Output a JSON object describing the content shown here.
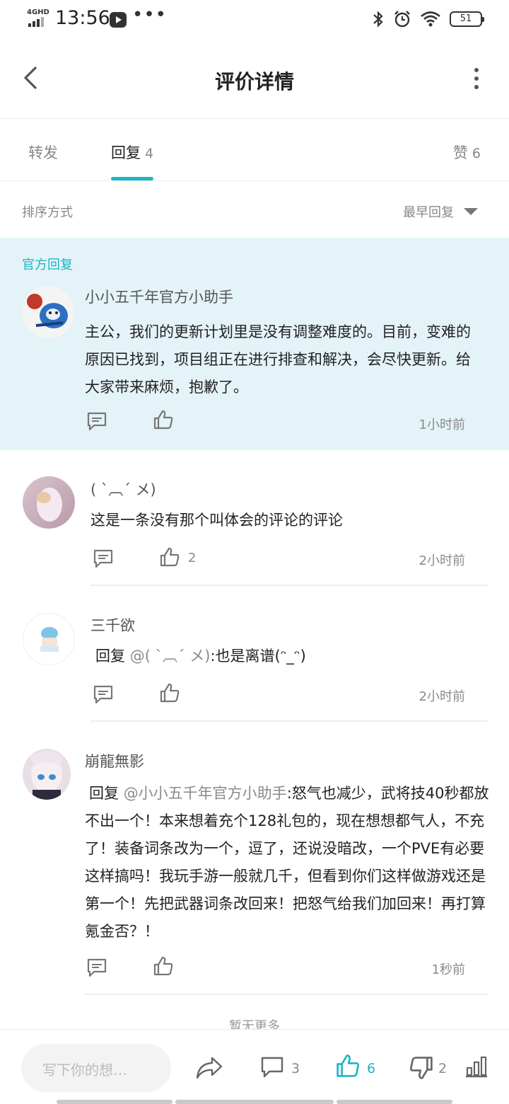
{
  "status_bar": {
    "network": "4GHD",
    "time": "13:56",
    "dots": "•••",
    "battery": "51"
  },
  "header": {
    "title": "评价详情"
  },
  "tabs": [
    {
      "label": "转发",
      "count": ""
    },
    {
      "label": "回复",
      "count": "4"
    },
    {
      "label": "赞",
      "count": "6"
    }
  ],
  "sort": {
    "label": "排序方式",
    "value": "最早回复"
  },
  "official": {
    "tag": "官方回复",
    "author": "小小五千年官方小助手",
    "text": "主公，我们的更新计划里是没有调整难度的。目前，变难的原因已找到，项目组正在进行排查和解决，会尽快更新。给大家带来麻烦，抱歉了。",
    "time": "1小时前"
  },
  "comments": [
    {
      "author": "( ˋ︹ˊ メ)",
      "prefix": "",
      "mention": "",
      "text": "这是一条没有那个叫体会的评论的评论",
      "likes": "2",
      "time": "2小时前"
    },
    {
      "author": "三千欲",
      "prefix": "回复 ",
      "mention": "@( ˋ︹ˊ メ)",
      "text": ":也是离谱(ᵔ_ᵔ)",
      "likes": "",
      "time": "2小时前"
    },
    {
      "author": "崩龍無影",
      "prefix": "回复 ",
      "mention": "@小小五千年官方小助手",
      "text": ":怒气也减少，武将技40秒都放不出一个！本来想着充个128礼包的，现在想想都气人，不充了！装备词条改为一个，逗了，还说没暗改，一个PVE有必要这样搞吗！我玩手游一般就几千，但看到你们这样做游戏还是第一个！先把武器词条改回来！把怒气给我们加回来！再打算氪金否？！",
      "likes": "",
      "time": "1秒前"
    }
  ],
  "no_more": "暂无更多",
  "bottom": {
    "input_placeholder": "写下你的想…",
    "comments": "3",
    "likes": "6",
    "dislikes": "2"
  },
  "colors": {
    "accent": "#1db4c4",
    "official_bg": "#e4f3f7"
  }
}
